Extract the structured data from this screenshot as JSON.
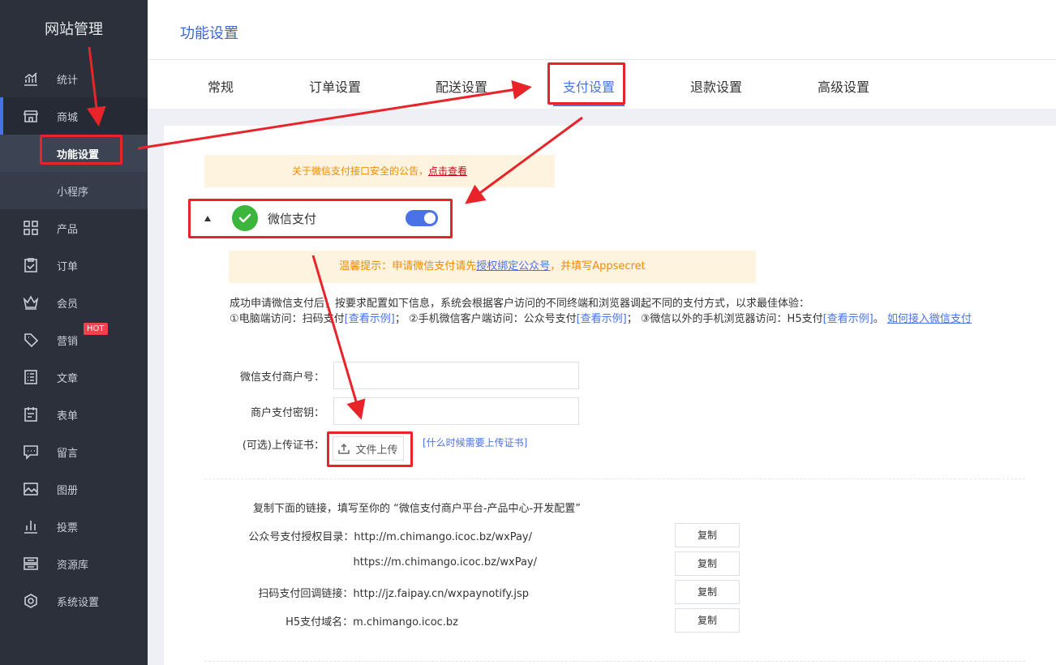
{
  "sidebar": {
    "brand": "网站管理",
    "items": [
      {
        "label": "统计",
        "icon": "chart-icon"
      },
      {
        "label": "商城",
        "icon": "store-icon"
      },
      {
        "label": "产品",
        "icon": "grid-icon"
      },
      {
        "label": "订单",
        "icon": "clipboard-icon"
      },
      {
        "label": "会员",
        "icon": "crown-icon"
      },
      {
        "label": "营销",
        "icon": "tag-icon",
        "badge": "HOT"
      },
      {
        "label": "文章",
        "icon": "article-icon"
      },
      {
        "label": "表单",
        "icon": "form-icon"
      },
      {
        "label": "留言",
        "icon": "message-icon"
      },
      {
        "label": "图册",
        "icon": "image-icon"
      },
      {
        "label": "投票",
        "icon": "vote-icon"
      },
      {
        "label": "资源库",
        "icon": "library-icon"
      },
      {
        "label": "系统设置",
        "icon": "settings-icon"
      }
    ],
    "subitems": [
      "功能设置",
      "小程序"
    ]
  },
  "header": {
    "title": "功能设置"
  },
  "tabs": [
    "常规",
    "订单设置",
    "配送设置",
    "支付设置",
    "退款设置",
    "高级设置"
  ],
  "notice1": {
    "text": "关于微信支付接口安全的公告，",
    "link": "点击查看"
  },
  "wechat": {
    "title": "微信支付"
  },
  "notice2": {
    "prefix": "温馨提示：申请微信支付请先",
    "link": "授权绑定公众号",
    "suffix": "，并填写Appsecret"
  },
  "desc": {
    "line1": "成功申请微信支付后，按要求配置如下信息，系统会根据客户访问的不同终端和浏览器调起不同的支付方式，以求最佳体验：",
    "p1": "①电脑端访问：扫码支付",
    "example": "[查看示例]",
    "p2": "；  ②手机微信客户端访问：公众号支付",
    "p3": "；  ③微信以外的手机浏览器访问：H5支付",
    "p4": "。  ",
    "howto": "如何接入微信支付"
  },
  "form": {
    "merchant_label": "微信支付商户号：",
    "key_label": "商户支付密钥：",
    "cert_label": "(可选)上传证书：",
    "upload_label": "文件上传",
    "cert_link": "[什么时候需要上传证书]"
  },
  "urls": {
    "intro": "复制下面的链接，填写至你的 “微信支付商户平台-产品中心-开发配置”",
    "rows": [
      "公众号支付授权目录：http://m.chimango.icoc.bz/wxPay/",
      "https://m.chimango.icoc.bz/wxPay/",
      "扫码支付回调链接：http://jz.faipay.cn/wxpaynotify.jsp",
      "H5支付域名：m.chimango.icoc.bz"
    ],
    "copy_label": "复制"
  },
  "colors": {
    "accent": "#4a72e8",
    "sidebar_bg": "#2b303b",
    "annotation": "#e8242a",
    "warning": "#f08c00"
  }
}
